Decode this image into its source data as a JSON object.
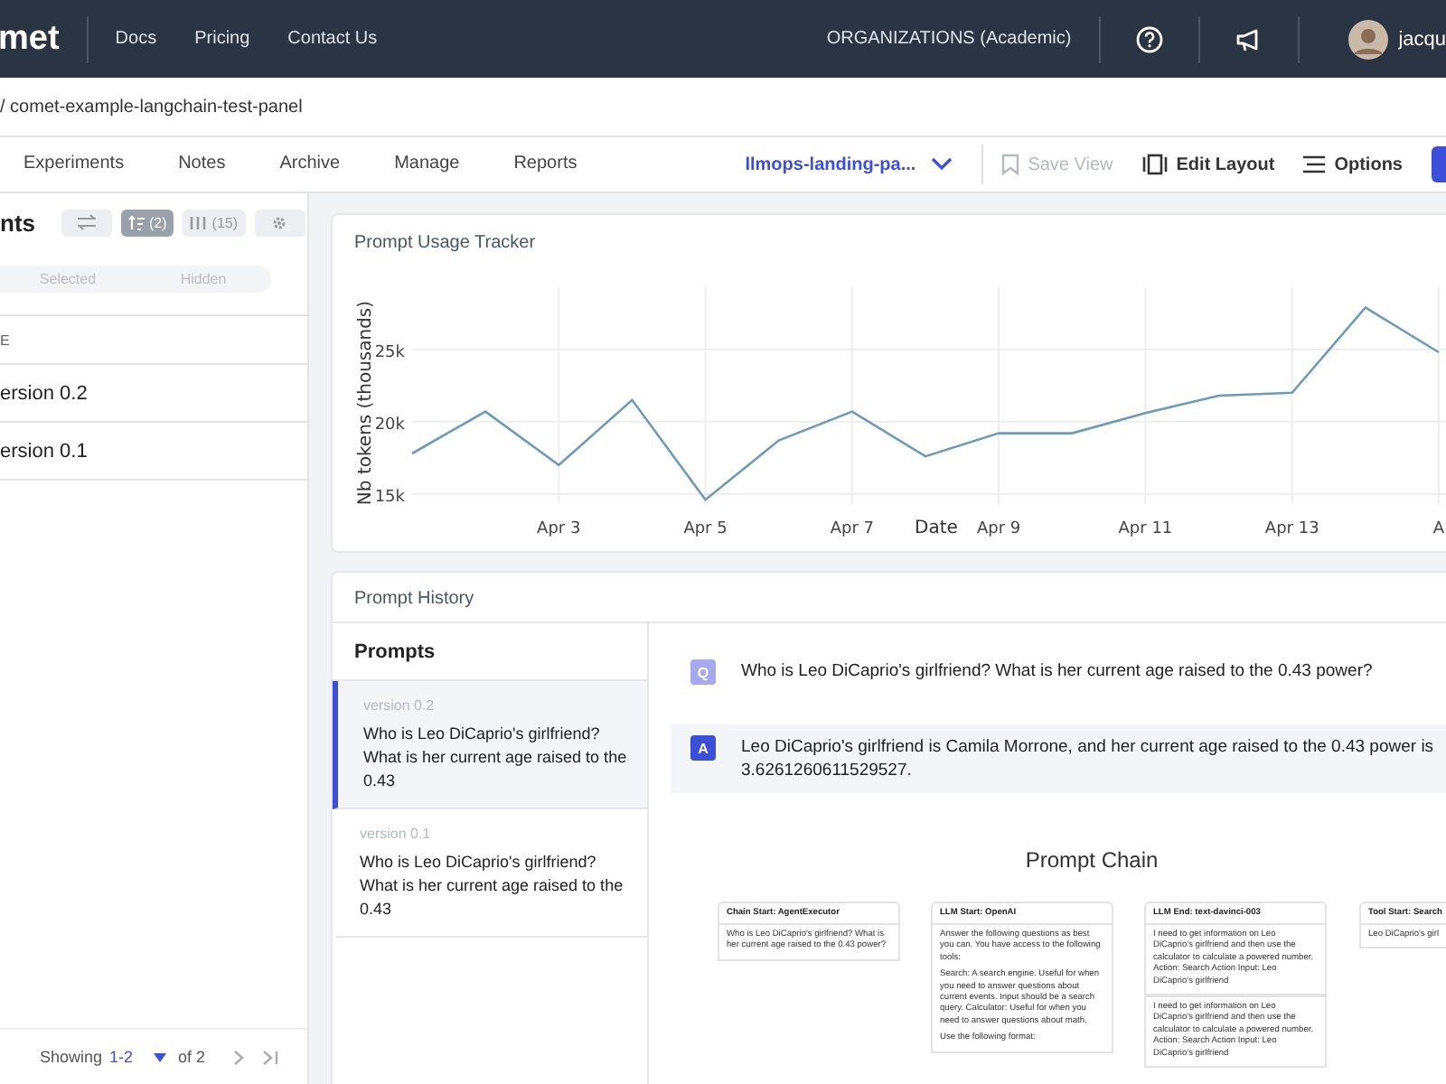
{
  "nav": {
    "logo": "met",
    "links": [
      "Docs",
      "Pricing",
      "Contact Us"
    ],
    "org": "ORGANIZATIONS (Academic)",
    "user": "jacqu"
  },
  "breadcrumb": "/ comet-example-langchain-test-panel",
  "tabs": [
    {
      "label": "Experiments",
      "selected": false
    },
    {
      "label": "Notes",
      "selected": false
    },
    {
      "label": "Archive",
      "selected": false
    },
    {
      "label": "Manage",
      "selected": false
    },
    {
      "label": "Reports",
      "selected": false
    }
  ],
  "view_select": "llmops-landing-pa...",
  "actions": [
    {
      "kind": "save",
      "label": "Save View",
      "disabled": true
    },
    {
      "kind": "layout",
      "label": "Edit Layout",
      "disabled": false
    },
    {
      "kind": "options",
      "label": "Options",
      "disabled": false
    }
  ],
  "sidebar": {
    "title": "nts",
    "tools": [
      {
        "kind": "swap",
        "selected": false
      },
      {
        "kind": "sort",
        "count": "(2)",
        "selected": true
      },
      {
        "kind": "columns",
        "count": "(15)",
        "selected": false
      },
      {
        "kind": "gear",
        "selected": false
      }
    ],
    "filters": [
      {
        "label": "Selected",
        "selected": false
      },
      {
        "label": "Hidden",
        "selected": false
      }
    ],
    "column": "E",
    "rows": [
      "ersion 0.2",
      "ersion 0.1"
    ],
    "pager": {
      "prefix": "Showing",
      "range": "1-2",
      "suffix": "of 2"
    }
  },
  "usage_panel": {
    "title": "Prompt Usage Tracker",
    "chart_data": {
      "type": "line",
      "xlabel": "Date",
      "ylabel": "Nb tokens (thousands)",
      "categories": [
        null,
        null,
        "Apr 3",
        null,
        "Apr 5",
        null,
        "Apr 7",
        null,
        "Apr 9",
        null,
        "Apr 11",
        null,
        "Apr 13",
        null,
        "A"
      ],
      "series": [
        {
          "color": "#6d9ab8",
          "values": [
            17.8,
            20.7,
            17.0,
            21.5,
            14.6,
            18.7,
            20.7,
            17.6,
            19.2,
            19.2,
            20.6,
            21.8,
            22.0,
            27.9,
            24.8
          ]
        }
      ],
      "ylim": [
        14.3,
        29.3
      ],
      "grid": true,
      "yticks": [
        {
          "value": 15,
          "label": "15k"
        },
        {
          "value": 20,
          "label": "20k"
        },
        {
          "value": 25,
          "label": "25k"
        }
      ]
    }
  },
  "history_panel": {
    "title": "Prompt History",
    "prompts_title": "Prompts",
    "prompts": [
      {
        "version": "version 0.2",
        "text": "Who is Leo DiCaprio's girlfriend? What is her current age raised to the 0.43",
        "selected": true
      },
      {
        "version": "version 0.1",
        "text": "Who is Leo DiCaprio's girlfriend? What is her current age raised to the 0.43",
        "selected": false
      }
    ],
    "messages": [
      {
        "kind": "question",
        "badge": "Q",
        "text": "Who is Leo DiCaprio's girlfriend? What is her current age raised to the 0.43 power?"
      },
      {
        "kind": "answer",
        "badge": "A",
        "text": "Leo DiCaprio's girlfriend is Camila Morrone, and her current age raised to the 0.43 power is 3.6261260611529527."
      }
    ],
    "chain": {
      "title": "Prompt Chain",
      "nodes": [
        {
          "title": "Chain Start: AgentExecutor",
          "cards": [
            [
              "Who is Leo DiCaprio's girlfriend? What is her current age raised to the 0.43 power?"
            ]
          ]
        },
        {
          "title": "LLM Start: OpenAI",
          "cards": [
            [
              "Answer the following questions as best you can. You have access to the following tools:",
              "Search: A search engine. Useful for when you need to answer questions about current events. Input should be a search query. Calculator: Useful for when you need to answer questions about math.",
              "Use the following format:"
            ]
          ]
        },
        {
          "title": "LLM End: text-davinci-003",
          "cards": [
            [
              "I need to get information on Leo DiCaprio's girlfriend and then use the calculator to calculate a powered number. Action: Search Action Input: Leo DiCaprio's girlfriend"
            ],
            [
              "I need to get information on Leo DiCaprio's girlfriend and then use the calculator to calculate a powered number. Action: Search Action Input: Leo DiCaprio's girlfriend"
            ]
          ]
        },
        {
          "title": "Tool Start: Search",
          "cards": [
            [
              "Leo DiCaprio's girl"
            ]
          ]
        }
      ]
    }
  }
}
